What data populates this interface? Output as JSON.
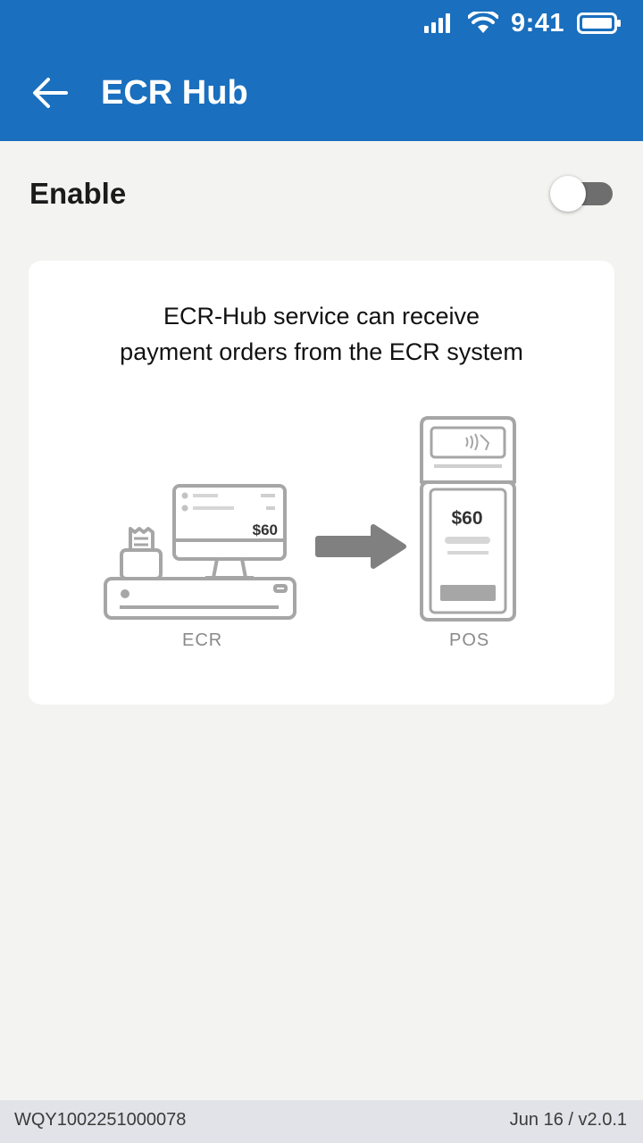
{
  "status_bar": {
    "time": "9:41",
    "icons": [
      "signal-icon",
      "wifi-icon",
      "battery-icon"
    ]
  },
  "header": {
    "title": "ECR Hub",
    "back_icon": "arrow-left-icon"
  },
  "settings": {
    "enable_label": "Enable",
    "enable_toggle_on": false
  },
  "card": {
    "description_line1": "ECR-Hub service can receive",
    "description_line2": "payment orders from the ECR system",
    "ecr_price": "$60",
    "pos_price": "$60",
    "ecr_caption": "ECR",
    "pos_caption": "POS"
  },
  "footer": {
    "device_id": "WQY1002251000078",
    "version": "Jun 16 / v2.0.1"
  },
  "colors": {
    "header_bg": "#1a6fbe",
    "page_bg": "#f3f3f1",
    "footer_bg": "#e1e3e8",
    "toggle_off": "#6e6e6e"
  }
}
